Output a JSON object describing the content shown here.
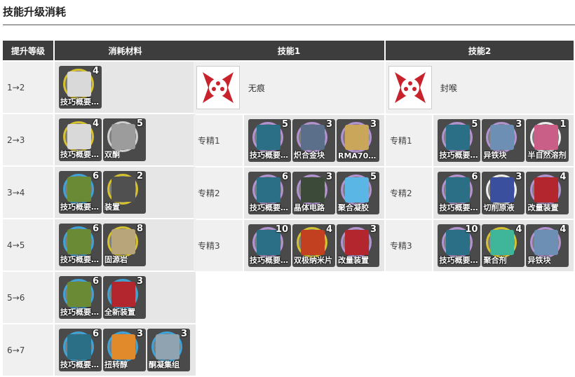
{
  "page_title": "技能升级消耗",
  "level_table": {
    "headers": [
      "提升等级",
      "消耗材料"
    ],
    "rows": [
      {
        "level": "1→2",
        "items": [
          {
            "name": "技巧概要…",
            "count": "4",
            "ring": "yellow",
            "art": "#d9d9d9"
          }
        ]
      },
      {
        "level": "2→3",
        "items": [
          {
            "name": "技巧概要…",
            "count": "4",
            "ring": "yellow",
            "art": "#d9d9d9"
          },
          {
            "name": "双酮",
            "count": "5",
            "ring": "gray",
            "art": "#9c9c9c"
          }
        ]
      },
      {
        "level": "3→4",
        "items": [
          {
            "name": "技巧概要…",
            "count": "6",
            "ring": "blue",
            "art": "#6b8a36"
          },
          {
            "name": "装置",
            "count": "2",
            "ring": "yellow",
            "art": "#505050"
          }
        ]
      },
      {
        "level": "4→5",
        "items": [
          {
            "name": "技巧概要…",
            "count": "6",
            "ring": "blue",
            "art": "#6b8a36"
          },
          {
            "name": "固源岩",
            "count": "8",
            "ring": "yellow",
            "art": "#b9a57a"
          }
        ]
      },
      {
        "level": "5→6",
        "items": [
          {
            "name": "技巧概要…",
            "count": "6",
            "ring": "blue",
            "art": "#6b8a36"
          },
          {
            "name": "全新装置",
            "count": "3",
            "ring": "blue",
            "art": "#b3262e"
          }
        ]
      },
      {
        "level": "6→7",
        "items": [
          {
            "name": "技巧概要…",
            "count": "6",
            "ring": "blue",
            "art": "#2b6f86"
          },
          {
            "name": "扭转醇",
            "count": "3",
            "ring": "blue",
            "art": "#e08a2c"
          },
          {
            "name": "酮凝集组",
            "count": "3",
            "ring": "blue",
            "art": "#8fa3b1"
          }
        ]
      }
    ]
  },
  "skill1": {
    "header": "技能1",
    "name": "无痕",
    "rows": [
      {
        "level": "专精1",
        "items": [
          {
            "name": "技巧概要…",
            "count": "5",
            "ring": "purple",
            "art": "#2b6f86"
          },
          {
            "name": "炽合金块",
            "count": "3",
            "ring": "purple",
            "art": "#5b6e8a"
          },
          {
            "name": "RMA70…",
            "count": "3",
            "ring": "purple",
            "art": "#c9a65a"
          }
        ]
      },
      {
        "level": "专精2",
        "items": [
          {
            "name": "技巧概要…",
            "count": "6",
            "ring": "purple",
            "art": "#2b6f86"
          },
          {
            "name": "晶体电路",
            "count": "3",
            "ring": "purple",
            "art": "#3c4a3a"
          },
          {
            "name": "聚合凝胶",
            "count": "5",
            "ring": "purple",
            "art": "#5ab6e4"
          }
        ]
      },
      {
        "level": "专精3",
        "items": [
          {
            "name": "技巧概要…",
            "count": "10",
            "ring": "purple",
            "art": "#2b6f86"
          },
          {
            "name": "双极纳米片",
            "count": "4",
            "ring": "yellow",
            "art": "#c2401f"
          },
          {
            "name": "改量装置",
            "count": "3",
            "ring": "purple",
            "art": "#b3262e"
          }
        ]
      }
    ]
  },
  "skill2": {
    "header": "技能2",
    "name": "封喉",
    "rows": [
      {
        "level": "专精1",
        "items": [
          {
            "name": "技巧概要…",
            "count": "5",
            "ring": "purple",
            "art": "#2b6f86"
          },
          {
            "name": "异铁块",
            "count": "3",
            "ring": "purple",
            "art": "#6d8fb3"
          },
          {
            "name": "半自然溶剂",
            "count": "1",
            "ring": "white",
            "art": "#c95f86"
          }
        ]
      },
      {
        "level": "专精2",
        "items": [
          {
            "name": "技巧概要…",
            "count": "6",
            "ring": "purple",
            "art": "#2b6f86"
          },
          {
            "name": "切削原液",
            "count": "3",
            "ring": "white",
            "art": "#3a4f9e"
          },
          {
            "name": "改量装置",
            "count": "4",
            "ring": "purple",
            "art": "#b3262e"
          }
        ]
      },
      {
        "level": "专精3",
        "items": [
          {
            "name": "技巧概要…",
            "count": "10",
            "ring": "purple",
            "art": "#2b6f86"
          },
          {
            "name": "聚合剂",
            "count": "4",
            "ring": "yellow",
            "art": "#3fb59a"
          },
          {
            "name": "异铁块",
            "count": "4",
            "ring": "purple",
            "art": "#6d8fb3"
          }
        ]
      }
    ]
  }
}
